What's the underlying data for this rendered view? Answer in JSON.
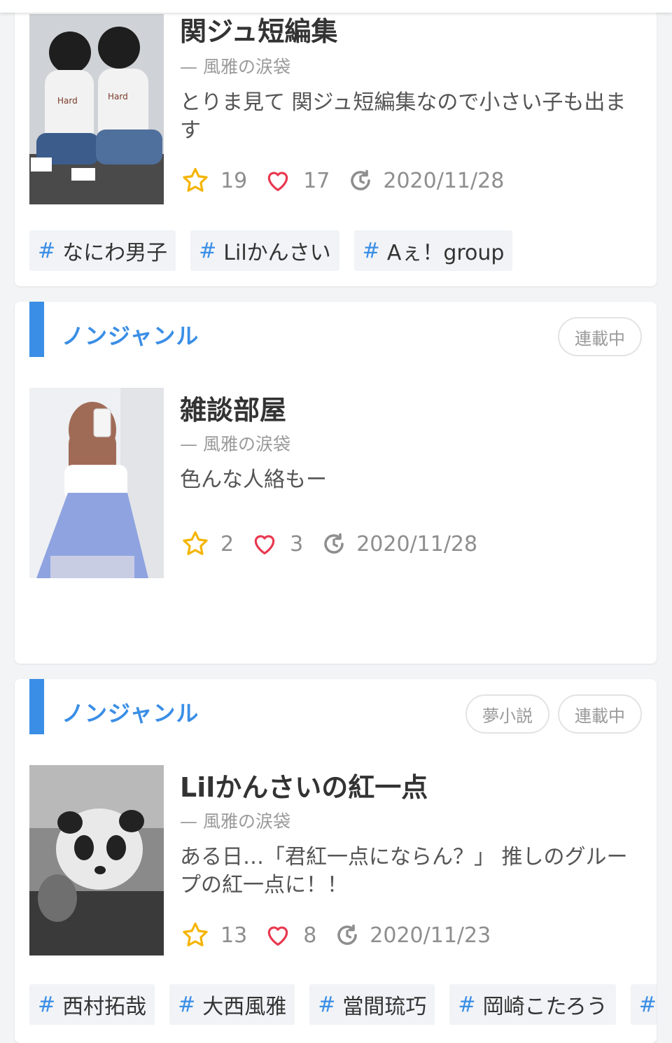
{
  "colors": {
    "accent": "#3a8ee6",
    "star": "#f5b400",
    "heart": "#e8384f",
    "muted": "#9a9a9a"
  },
  "cards": [
    {
      "title": "関ジュ短編集",
      "author": "— 風雅の涙袋",
      "description": "とりま見て 関ジュ短編集なので小さい子も出ます",
      "stars": "19",
      "hearts": "17",
      "updated": "2020/11/28",
      "tags": [
        "なにわ男子",
        "Lilかんさい",
        "Aぇ！group"
      ]
    },
    {
      "genre": "ノンジャンル",
      "badges": [
        "連載中"
      ],
      "title": "雑談部屋",
      "author": "— 風雅の涙袋",
      "description": "色んな人絡もー",
      "stars": "2",
      "hearts": "3",
      "updated": "2020/11/28"
    },
    {
      "genre": "ノンジャンル",
      "badges": [
        "夢小説",
        "連載中"
      ],
      "title": "Lilかんさいの紅一点",
      "author": "— 風雅の涙袋",
      "description": "ある日…「君紅一点にならん？」 推しのグループの紅一点に！！",
      "stars": "13",
      "hearts": "8",
      "updated": "2020/11/23",
      "tags": [
        "西村拓哉",
        "大西風雅",
        "當間琉巧",
        "岡崎こたろう"
      ]
    }
  ],
  "icons": {
    "star": "star-icon",
    "heart": "heart-icon",
    "updated": "refresh-clock-icon",
    "tag": "hash-icon"
  },
  "tag_hash": "#"
}
